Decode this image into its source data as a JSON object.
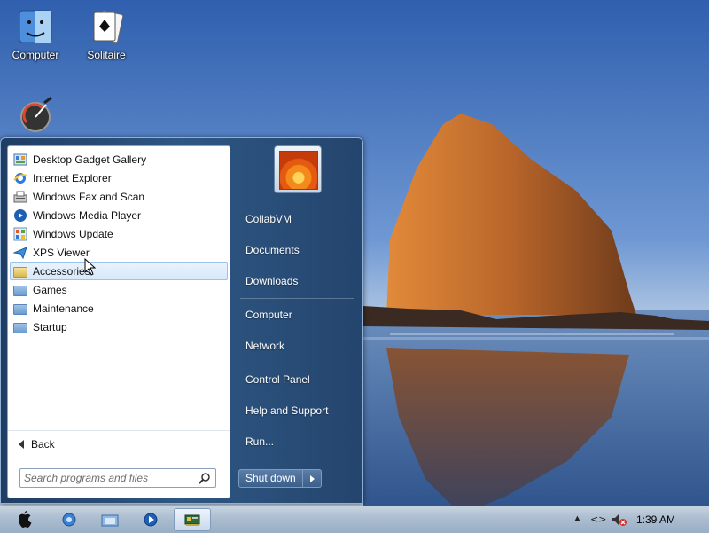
{
  "desktop": {
    "icons": [
      {
        "label": "Computer",
        "icon": "finder-face-icon"
      },
      {
        "label": "Solitaire",
        "icon": "solitaire-cards-icon"
      },
      {
        "label": "",
        "icon": "gauge-gadget-icon"
      }
    ]
  },
  "start_menu": {
    "programs": [
      {
        "label": "Desktop Gadget Gallery",
        "icon": "gadget-gallery-icon"
      },
      {
        "label": "Internet Explorer",
        "icon": "internet-explorer-icon"
      },
      {
        "label": "Windows Fax and Scan",
        "icon": "fax-scan-icon"
      },
      {
        "label": "Windows Media Player",
        "icon": "media-player-icon"
      },
      {
        "label": "Windows Update",
        "icon": "windows-update-icon"
      },
      {
        "label": "XPS Viewer",
        "icon": "xps-viewer-icon"
      },
      {
        "label": "Accessories",
        "icon": "folder-open-icon",
        "selected": true
      },
      {
        "label": "Games",
        "icon": "folder-icon"
      },
      {
        "label": "Maintenance",
        "icon": "folder-icon"
      },
      {
        "label": "Startup",
        "icon": "folder-icon"
      }
    ],
    "back_label": "Back",
    "search_placeholder": "Search programs and files",
    "right_items": [
      "CollabVM",
      "Documents",
      "Downloads",
      "Computer",
      "Network",
      "Control Panel",
      "Help and Support",
      "Run..."
    ],
    "shutdown_label": "Shut down"
  },
  "taskbar": {
    "clock": "1:39 AM",
    "start_icon": "apple-logo-icon",
    "pinned": [
      "internet-explorer-icon",
      "explorer-folder-icon",
      "media-player-icon",
      "network-card-icon"
    ]
  },
  "colors": {
    "sky": "#5d87c6",
    "rock": "#b96a2c",
    "menu_blue": "#2e5784",
    "selected_bg": "#d6e8fa"
  }
}
